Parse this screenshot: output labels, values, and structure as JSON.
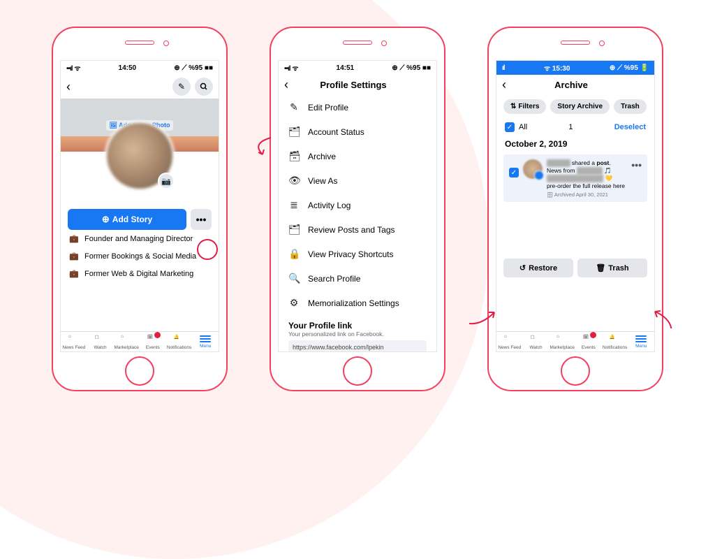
{
  "phone1": {
    "status": {
      "time": "14:50",
      "right": "⊕ ⟋ %95 ■■",
      "signal": "••ıl",
      "wifi": "ᯤ"
    },
    "cover_label": "Add Cover Photo",
    "add_story": "Add Story",
    "more": "•••",
    "bio": [
      {
        "icon": "💼",
        "text": "Founder and Managing Director"
      },
      {
        "icon": "💼",
        "text": "Former Bookings & Social Media"
      },
      {
        "icon": "💼",
        "text": "Former Web & Digital Marketing"
      }
    ]
  },
  "phone2": {
    "status": {
      "time": "14:51",
      "right": "⊕ ⟋ %95 ■■",
      "signal": "••ıl",
      "wifi": "ᯤ"
    },
    "title": "Profile Settings",
    "items": [
      {
        "icon": "✎",
        "label": "Edit Profile"
      },
      {
        "icon": "🗂",
        "label": "Account Status"
      },
      {
        "icon": "🗃",
        "label": "Archive"
      },
      {
        "icon": "👁",
        "label": "View As"
      },
      {
        "icon": "≣",
        "label": "Activity Log"
      },
      {
        "icon": "🗂",
        "label": "Review Posts and Tags"
      },
      {
        "icon": "🔒",
        "label": "View Privacy Shortcuts"
      },
      {
        "icon": "🔍",
        "label": "Search Profile"
      },
      {
        "icon": "⚙",
        "label": "Memorialization Settings"
      }
    ],
    "link": {
      "title": "Your Profile link",
      "sub": "Your personalized link on Facebook.",
      "url": "https://www.facebook.com/lpekin"
    }
  },
  "phone3": {
    "status": {
      "time": "ᯤ 15:30",
      "right": "⊕ ⟋ %95 🔋",
      "signal": "ıl"
    },
    "title": "Archive",
    "pills": [
      "Filters",
      "Story Archive",
      "Trash"
    ],
    "all": "All",
    "count": "1",
    "deselect": "Deselect",
    "date": "October 2, 2019",
    "post": {
      "line1a": "shared a ",
      "line1b": "post",
      "line2": "News from",
      "line3": "pre-order the full release here",
      "archived": "Archived April 30, 2021"
    },
    "restore": "Restore",
    "trash": "Trash"
  },
  "tabs": [
    {
      "icon": "⌂",
      "label": "News Feed"
    },
    {
      "icon": "▷",
      "label": "Watch"
    },
    {
      "icon": "⌂",
      "label": "Marketplace"
    },
    {
      "icon": "🗓",
      "label": "Events",
      "badge": "●"
    },
    {
      "icon": "🔔",
      "label": "Notifications"
    },
    {
      "icon": "≡",
      "label": "Menu",
      "active": true
    }
  ]
}
